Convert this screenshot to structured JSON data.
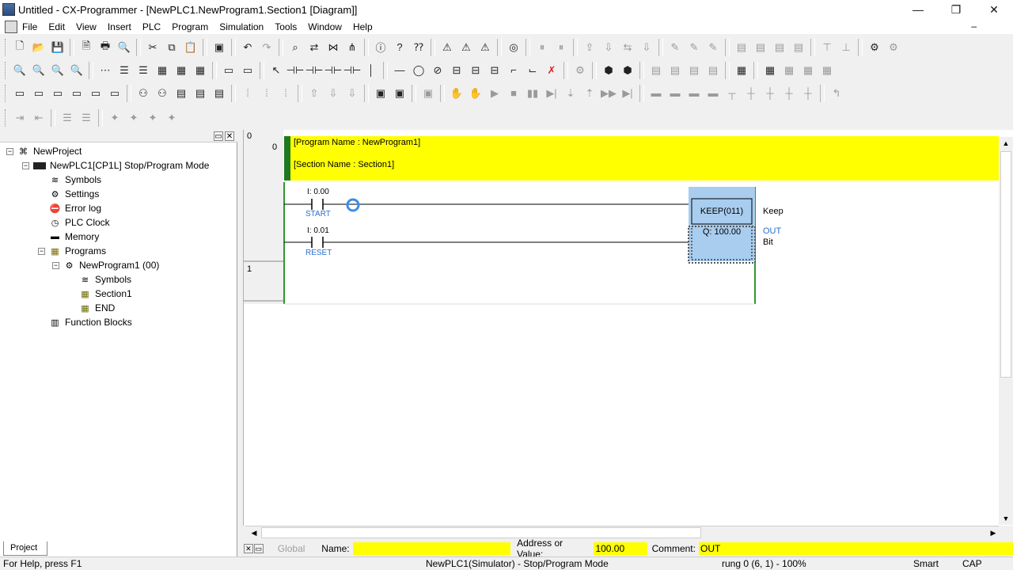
{
  "window": {
    "title": "Untitled - CX-Programmer - [NewPLC1.NewProgram1.Section1 [Diagram]]"
  },
  "menu": [
    "File",
    "Edit",
    "View",
    "Insert",
    "PLC",
    "Program",
    "Simulation",
    "Tools",
    "Window",
    "Help"
  ],
  "menu_restore_glyph": "–",
  "project_tree": {
    "root": "NewProject",
    "plc": "NewPLC1[CP1L] Stop/Program Mode",
    "items": [
      "Symbols",
      "Settings",
      "Error log",
      "PLC Clock",
      "Memory",
      "Programs"
    ],
    "program": "NewProgram1 (00)",
    "program_items": [
      "Symbols",
      "Section1",
      "END"
    ],
    "function_blocks": "Function Blocks",
    "tab": "Project"
  },
  "diagram": {
    "header_rung_col": "0",
    "rungs": [
      "0",
      "1"
    ],
    "program_name": "[Program Name : NewProgram1]",
    "section_name": "[Section Name : Section1]",
    "contacts": [
      {
        "address": "I: 0.00",
        "name": "START"
      },
      {
        "address": "I: 0.01",
        "name": "RESET"
      }
    ],
    "instruction": {
      "mnemonic": "KEEP(011)",
      "label": "Keep",
      "operand": "Q: 100.00",
      "operand_name": "OUT",
      "operand_desc": "Bit"
    }
  },
  "bottom_bar": {
    "global": "Global",
    "name_label": "Name:",
    "name_value": "",
    "address_label": "Address or Value:",
    "address_value": "100.00",
    "comment_label": "Comment:",
    "comment_value": "OUT"
  },
  "status": {
    "help": "For Help, press F1",
    "mode": "NewPLC1(Simulator) - Stop/Program Mode",
    "position": "rung 0 (6, 1)  - 100%",
    "smart": "Smart",
    "caps": "CAP"
  },
  "colors": {
    "highlight": "#ffff00",
    "rail": "#2e9a2e",
    "block_fill": "#a8cdef",
    "contact_label": "#2a6fd0"
  }
}
